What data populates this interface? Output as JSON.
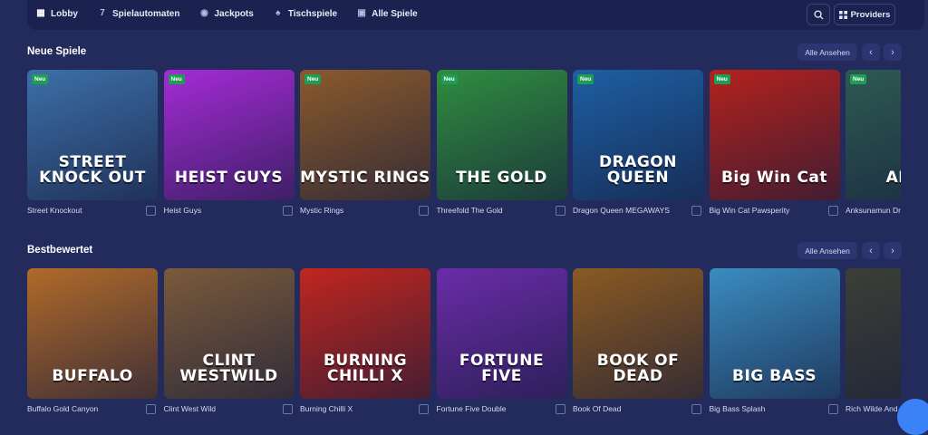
{
  "nav": {
    "items": [
      {
        "label": "Lobby",
        "icon": "grid-icon"
      },
      {
        "label": "Spielautomaten",
        "icon": "seven-icon"
      },
      {
        "label": "Jackpots",
        "icon": "coins-icon"
      },
      {
        "label": "Tischspiele",
        "icon": "cards-icon"
      },
      {
        "label": "Alle Spiele",
        "icon": "squares-icon"
      }
    ],
    "providers_label": "Providers"
  },
  "sections": [
    {
      "title": "Neue Spiele",
      "see_all": "Alle Ansehen",
      "games": [
        {
          "name": "Street Knockout",
          "badge": "Neu",
          "art": "STREET KNOCK OUT",
          "bg": "#3c6fa8"
        },
        {
          "name": "Heist Guys",
          "badge": "Neu",
          "art": "HEIST GUYS",
          "bg": "#a52bd6"
        },
        {
          "name": "Mystic Rings",
          "badge": "Neu",
          "art": "MYSTIC RINGS",
          "bg": "#8a5a2b"
        },
        {
          "name": "Threefold The Gold",
          "badge": "Neu",
          "art": "THE GOLD",
          "bg": "#2f8d3f"
        },
        {
          "name": "Dragon Queen MEGAWAYS",
          "badge": "Neu",
          "art": "DRAGON QUEEN",
          "bg": "#1d5fa3"
        },
        {
          "name": "Big Win Cat Pawsperity",
          "badge": "Neu",
          "art": "Big Win Cat",
          "bg": "#b3221d"
        },
        {
          "name": "Anksunamun Dr",
          "badge": "Neu",
          "art": "ANKS",
          "bg": "#2d5a52"
        }
      ]
    },
    {
      "title": "Bestbewertet",
      "see_all": "Alle Ansehen",
      "games": [
        {
          "name": "Buffalo Gold Canyon",
          "badge": "",
          "art": "BUFFALO",
          "bg": "#b06a2a"
        },
        {
          "name": "Clint West Wild",
          "badge": "",
          "art": "CLINT WESTWILD",
          "bg": "#7a5a3a"
        },
        {
          "name": "Burning Chilli X",
          "badge": "",
          "art": "BURNING CHILLI X",
          "bg": "#c0261f"
        },
        {
          "name": "Fortune Five Double",
          "badge": "",
          "art": "FORTUNE FIVE",
          "bg": "#6a2ca8"
        },
        {
          "name": "Book Of Dead",
          "badge": "",
          "art": "BOOK OF DEAD",
          "bg": "#8a5a22"
        },
        {
          "name": "Big Bass Splash",
          "badge": "",
          "art": "BIG BASS",
          "bg": "#3a8cc0"
        },
        {
          "name": "Rich Wilde And",
          "badge": "",
          "art": "",
          "bg": "#3b3f36"
        }
      ]
    }
  ]
}
